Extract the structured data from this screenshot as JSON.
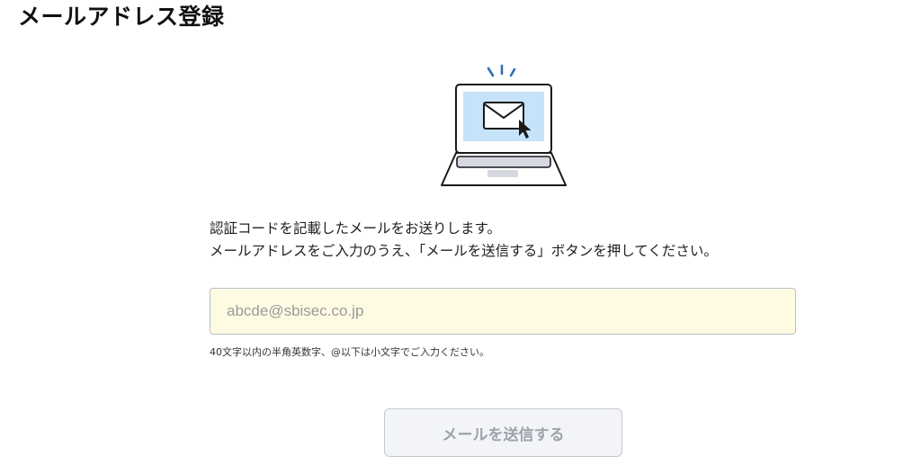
{
  "page": {
    "title": "メールアドレス登録"
  },
  "illustration": {
    "icon": "laptop-mail-icon",
    "screen_color": "#c6e3fa",
    "spark_color": "#2f6fb5"
  },
  "message": {
    "line1": "認証コードを記載したメールをお送りします。",
    "line2": "メールアドレスをご入力のうえ、「メールを送信する」ボタンを押してください。"
  },
  "email_field": {
    "placeholder": "abcde@sbisec.co.jp",
    "value": "",
    "background": "#fffbe3"
  },
  "hint": "40文字以内の半角英数字、@以下は小文字でご入力ください。",
  "submit": {
    "label": "メールを送信する",
    "state": "disabled"
  }
}
